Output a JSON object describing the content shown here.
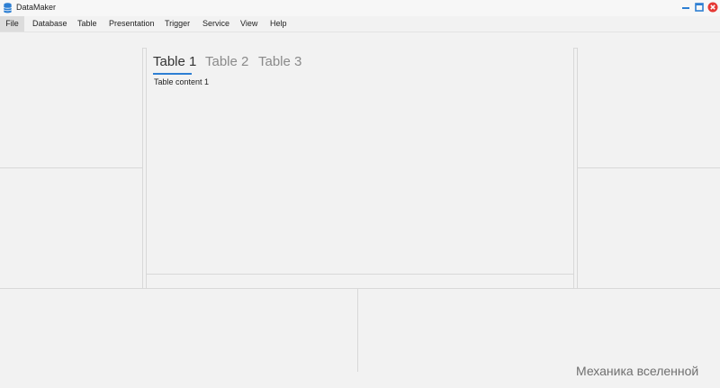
{
  "window": {
    "title": "DataMaker",
    "icon": "database-icon"
  },
  "menu": {
    "file": "File",
    "database": "Database",
    "table": "Table",
    "presentation": "Presentation",
    "trigger": "Trigger",
    "service": "Service",
    "view": "View",
    "help": "Help"
  },
  "center": {
    "tabs": [
      {
        "label": "Table 1",
        "active": true
      },
      {
        "label": "Table 2",
        "active": false
      },
      {
        "label": "Table 3",
        "active": false
      }
    ],
    "content": "Table content 1"
  },
  "watermark": "Механика вселенной",
  "colors": {
    "tab_underline": "#2d7fd3",
    "window_button_blue": "#2d7fd3",
    "close_red": "#e53935"
  }
}
